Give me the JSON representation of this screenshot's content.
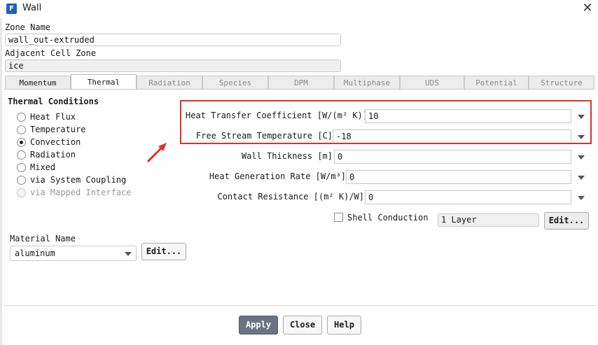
{
  "window": {
    "app_icon_letter": "F",
    "title": "Wall",
    "close_glyph": "✕"
  },
  "zone": {
    "zone_name_label": "Zone Name",
    "zone_name_value": "wall_out-extruded",
    "adjacent_label": "Adjacent Cell Zone",
    "adjacent_value": "ice"
  },
  "tabs": [
    {
      "label": "Momentum"
    },
    {
      "label": "Thermal"
    },
    {
      "label": "Radiation"
    },
    {
      "label": "Species"
    },
    {
      "label": "DPM"
    },
    {
      "label": "Multiphase"
    },
    {
      "label": "UDS"
    },
    {
      "label": "Potential"
    },
    {
      "label": "Structure"
    }
  ],
  "active_tab": "Thermal",
  "thermal": {
    "section_title": "Thermal Conditions",
    "options": [
      {
        "label": "Heat Flux",
        "selected": false,
        "enabled": true
      },
      {
        "label": "Temperature",
        "selected": false,
        "enabled": true
      },
      {
        "label": "Convection",
        "selected": true,
        "enabled": true
      },
      {
        "label": "Radiation",
        "selected": false,
        "enabled": true
      },
      {
        "label": "Mixed",
        "selected": false,
        "enabled": true
      },
      {
        "label": "via System Coupling",
        "selected": false,
        "enabled": true
      },
      {
        "label": "via Mapped Interface",
        "selected": false,
        "enabled": false
      }
    ]
  },
  "material": {
    "label": "Material Name",
    "value": "aluminum",
    "edit_label": "Edit..."
  },
  "params": {
    "htc_label": "Heat Transfer Coefficient [W/(m² K)]",
    "htc_value": "10",
    "fst_label": "Free Stream Temperature [C]",
    "fst_value": "-18",
    "thickness_label": "Wall Thickness [m]",
    "thickness_value": "0",
    "heatgen_label": "Heat Generation Rate [W/m³]",
    "heatgen_value": "0",
    "contact_label": "Contact Resistance [(m² K)/W]",
    "contact_value": "0"
  },
  "shell": {
    "checkbox_label": "Shell Conduction",
    "checked": false,
    "layers_value": "1 Layer",
    "edit_label": "Edit..."
  },
  "annotation": {
    "highlight_color": "#e0302d"
  },
  "buttons": {
    "apply": "Apply",
    "close": "Close",
    "help": "Help"
  }
}
